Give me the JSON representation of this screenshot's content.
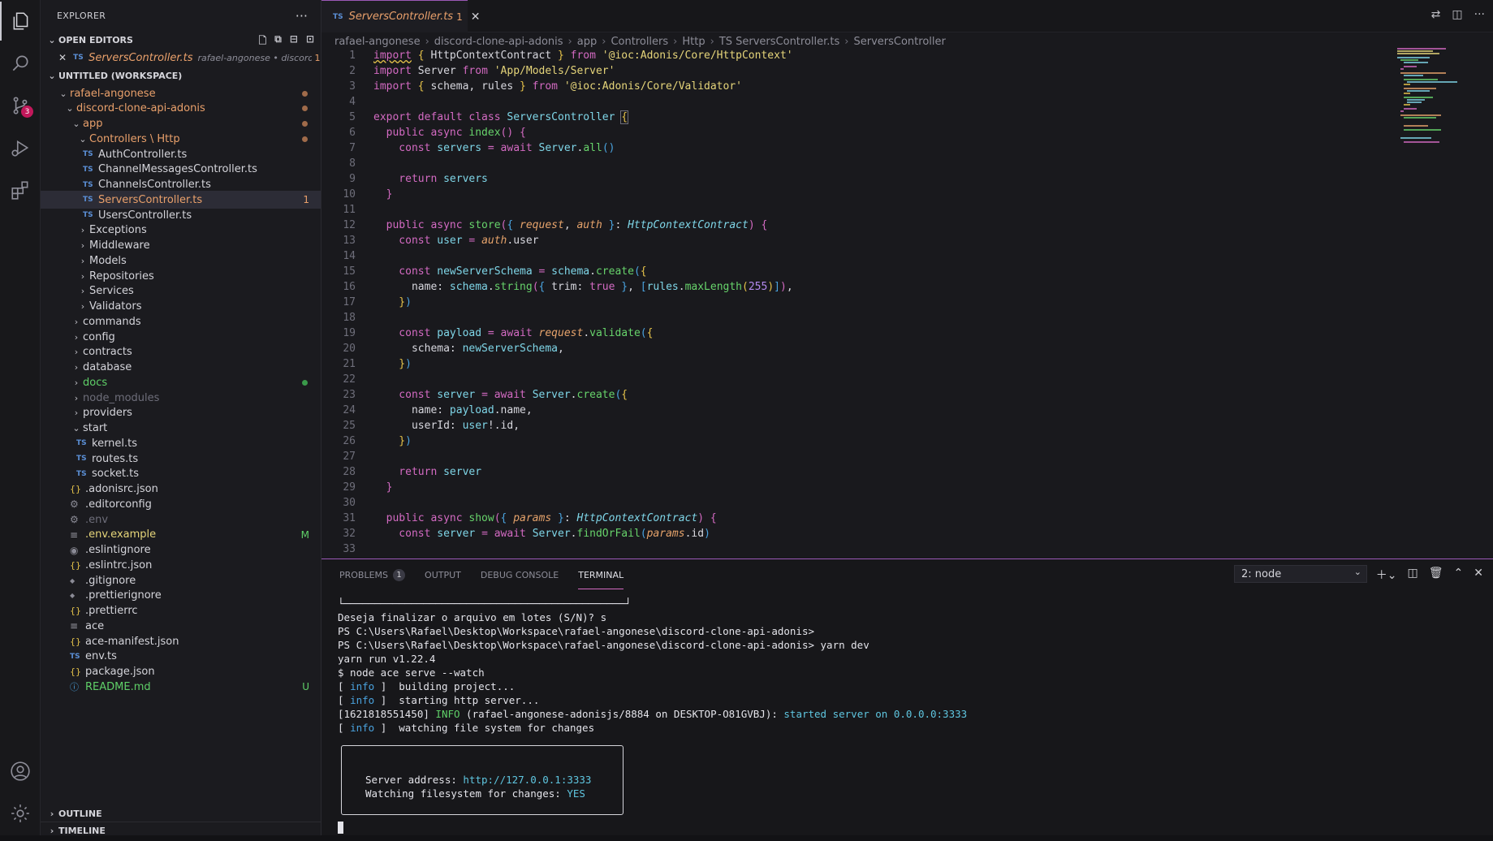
{
  "sidebar": {
    "title": "EXPLORER",
    "open_editors_label": "OPEN EDITORS",
    "open_editor": {
      "name": "ServersController.ts",
      "path": "rafael-angonese • discord...",
      "count": "1"
    },
    "workspace_label": "UNTITLED (WORKSPACE)",
    "tree": [
      {
        "label": "rafael-angonese",
        "kind": "folder-open",
        "color": "#e9a06b",
        "dot": "#a06b4a"
      },
      {
        "label": "discord-clone-api-adonis",
        "kind": "folder-open",
        "color": "#e9a06b",
        "dot": "#a06b4a"
      },
      {
        "label": "app",
        "kind": "folder-open",
        "color": "#e9a06b",
        "dot": "#a06b4a"
      },
      {
        "label": "Controllers \\ Http",
        "kind": "folder-open",
        "color": "#e9a06b",
        "dot": "#a06b4a"
      },
      {
        "label": "AuthController.ts",
        "kind": "ts"
      },
      {
        "label": "ChannelMessagesController.ts",
        "kind": "ts"
      },
      {
        "label": "ChannelsController.ts",
        "kind": "ts"
      },
      {
        "label": "ServersController.ts",
        "kind": "ts",
        "color": "#e9a06b",
        "badge": "1",
        "selected": true
      },
      {
        "label": "UsersController.ts",
        "kind": "ts"
      },
      {
        "label": "Exceptions",
        "kind": "folder"
      },
      {
        "label": "Middleware",
        "kind": "folder"
      },
      {
        "label": "Models",
        "kind": "folder"
      },
      {
        "label": "Repositories",
        "kind": "folder"
      },
      {
        "label": "Services",
        "kind": "folder"
      },
      {
        "label": "Validators",
        "kind": "folder"
      },
      {
        "label": "commands",
        "kind": "folder"
      },
      {
        "label": "config",
        "kind": "folder"
      },
      {
        "label": "contracts",
        "kind": "folder"
      },
      {
        "label": "database",
        "kind": "folder"
      },
      {
        "label": "docs",
        "kind": "folder",
        "color": "#5fd068",
        "dot": "#3a9a4a"
      },
      {
        "label": "node_modules",
        "kind": "folder",
        "color": "#6e6e7a"
      },
      {
        "label": "providers",
        "kind": "folder"
      },
      {
        "label": "start",
        "kind": "folder-open"
      },
      {
        "label": "kernel.ts",
        "kind": "ts"
      },
      {
        "label": "routes.ts",
        "kind": "ts"
      },
      {
        "label": "socket.ts",
        "kind": "ts"
      },
      {
        "label": ".adonisrc.json",
        "kind": "json"
      },
      {
        "label": ".editorconfig",
        "kind": "gear"
      },
      {
        "label": ".env",
        "kind": "gear",
        "color": "#6e6e7a"
      },
      {
        "label": ".env.example",
        "kind": "lines",
        "color": "#e6d57a",
        "status": "M",
        "status_color": "#5fd068"
      },
      {
        "label": ".eslintignore",
        "kind": "circle"
      },
      {
        "label": ".eslintrc.json",
        "kind": "json"
      },
      {
        "label": ".gitignore",
        "kind": "diamond"
      },
      {
        "label": ".prettierignore",
        "kind": "diamond"
      },
      {
        "label": ".prettierrc",
        "kind": "json"
      },
      {
        "label": "ace",
        "kind": "lines"
      },
      {
        "label": "ace-manifest.json",
        "kind": "json"
      },
      {
        "label": "env.ts",
        "kind": "ts"
      },
      {
        "label": "package.json",
        "kind": "json"
      },
      {
        "label": "README.md",
        "kind": "info",
        "color": "#5fd068",
        "status": "U",
        "status_color": "#5fd068"
      }
    ],
    "outline_label": "OUTLINE",
    "timeline_label": "TIMELINE"
  },
  "editor": {
    "tab": {
      "ts": "TS",
      "name": "ServersController.ts",
      "count": "1"
    },
    "breadcrumb": [
      "rafael-angonese",
      "discord-clone-api-adonis",
      "app",
      "Controllers",
      "Http",
      "TS ServersController.ts",
      "ServersController"
    ]
  },
  "panel": {
    "tabs": [
      "PROBLEMS",
      "OUTPUT",
      "DEBUG CONSOLE",
      "TERMINAL"
    ],
    "problems_count": "1",
    "terminal_select": "2: node",
    "terminal": {
      "box_top": "└──────────────────────────────────────────────┘",
      "line1": "Deseja finalizar o arquivo em lotes (S/N)? s",
      "line2": "PS C:\\Users\\Rafael\\Desktop\\Workspace\\rafael-angonese\\discord-clone-api-adonis>",
      "line3_prefix": "PS C:\\Users\\Rafael\\Desktop\\Workspace\\rafael-angonese\\discord-clone-api-adonis>",
      "line3_cmd": " yarn dev",
      "line4": "yarn run v1.22.4",
      "line5": "$ node ace serve --watch",
      "info_tag": "info",
      "line6": "  building project...",
      "line7": "  starting http server...",
      "line8_ts": "[1621818551450] ",
      "line8_level": "INFO",
      "line8_mid": " (rafael-angonese-adonisjs/8884 on DESKTOP-O81GVBJ): ",
      "line8_msg": "started server on 0.0.0.0:3333",
      "line9": "  watching file system for changes",
      "server_label": "Server address: ",
      "server_url": "http://127.0.0.1:3333",
      "watch_label": "Watching filesystem for changes: ",
      "watch_value": "YES"
    }
  }
}
